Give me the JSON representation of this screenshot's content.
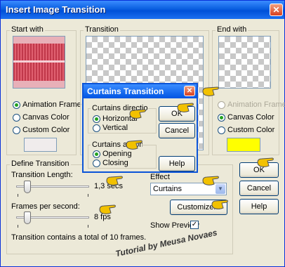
{
  "window": {
    "title": "Insert Image Transition",
    "close_glyph": "✕"
  },
  "start_with": {
    "label": "Start with",
    "options": [
      "Animation Frame",
      "Canvas Color",
      "Custom Color"
    ],
    "selected": 0
  },
  "transition_preview": {
    "label": "Transition"
  },
  "end_with": {
    "label": "End with",
    "options": [
      "Animation Frame",
      "Canvas Color",
      "Custom Color"
    ],
    "selected": 1,
    "custom_color": "#ffff00"
  },
  "define": {
    "label": "Define Transition",
    "length_label": "Transition Length:",
    "length_value": "1,3 secs",
    "length_fraction": 0.15,
    "fps_label": "Frames per second:",
    "fps_value": "8 fps",
    "fps_fraction": 0.15,
    "effect_label": "Effect",
    "effect_value": "Curtains",
    "customize_label": "Customize...",
    "show_preview_label": "Show Preview",
    "show_preview_checked": true,
    "summary": "Transition contains a total of 10 frames."
  },
  "buttons": {
    "ok": "OK",
    "cancel": "Cancel",
    "help": "Help"
  },
  "curtains_dialog": {
    "title": "Curtains Transition",
    "close_glyph": "✕",
    "direction_label": "Curtains direction",
    "directions": [
      "Horizontal",
      "Vertical"
    ],
    "direction_selected": 0,
    "action_label": "Curtains action",
    "actions": [
      "Opening",
      "Closing"
    ],
    "action_selected": 0,
    "ok": "OK",
    "cancel": "Cancel",
    "help": "Help"
  },
  "watermark": "Tutorial by Meusa Novaes",
  "colors": {
    "accent": "#0b54d8",
    "hand": "#f2c100",
    "custom_swatch_start": "#f0ecec"
  }
}
